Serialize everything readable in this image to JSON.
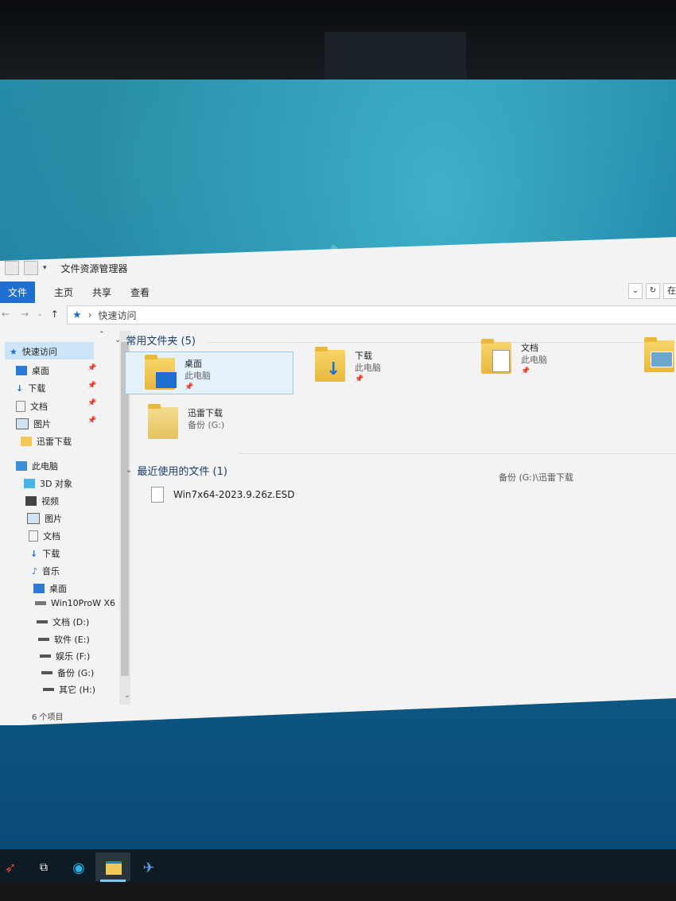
{
  "window": {
    "title": "文件资源管理器"
  },
  "ribbon": {
    "file": "文件",
    "tabs": [
      "主页",
      "共享",
      "查看"
    ],
    "search_placeholder": "在"
  },
  "address": {
    "path": "快速访问"
  },
  "nav": {
    "quick_access": "快速访问",
    "quick_items": [
      "桌面",
      "下载",
      "文档",
      "图片",
      "迅雷下载"
    ],
    "this_pc": "此电脑",
    "pc_items": [
      "3D 对象",
      "视频",
      "图片",
      "文档",
      "下载",
      "音乐",
      "桌面",
      "Win10ProW X6",
      "文档 (D:)",
      "软件 (E:)",
      "娱乐 (F:)",
      "备份 (G:)",
      "其它 (H:)"
    ]
  },
  "frequent": {
    "header": "常用文件夹 (5)",
    "items": [
      {
        "name": "桌面",
        "location": "此电脑"
      },
      {
        "name": "下载",
        "location": "此电脑"
      },
      {
        "name": "文档",
        "location": "此电脑"
      },
      {
        "name": "迅雷下载",
        "location": "备份 (G:)"
      }
    ]
  },
  "recent": {
    "header": "最近使用的文件 (1)",
    "files": [
      {
        "name": "Win7x64-2023.9.26z.ESD",
        "path": "备份 (G:)\\迅雷下载"
      }
    ]
  },
  "status": {
    "count": "6 个项目"
  },
  "colors": {
    "accent": "#1f6fd1",
    "selection": "#cce4f7",
    "folder": "#e9b83c"
  }
}
